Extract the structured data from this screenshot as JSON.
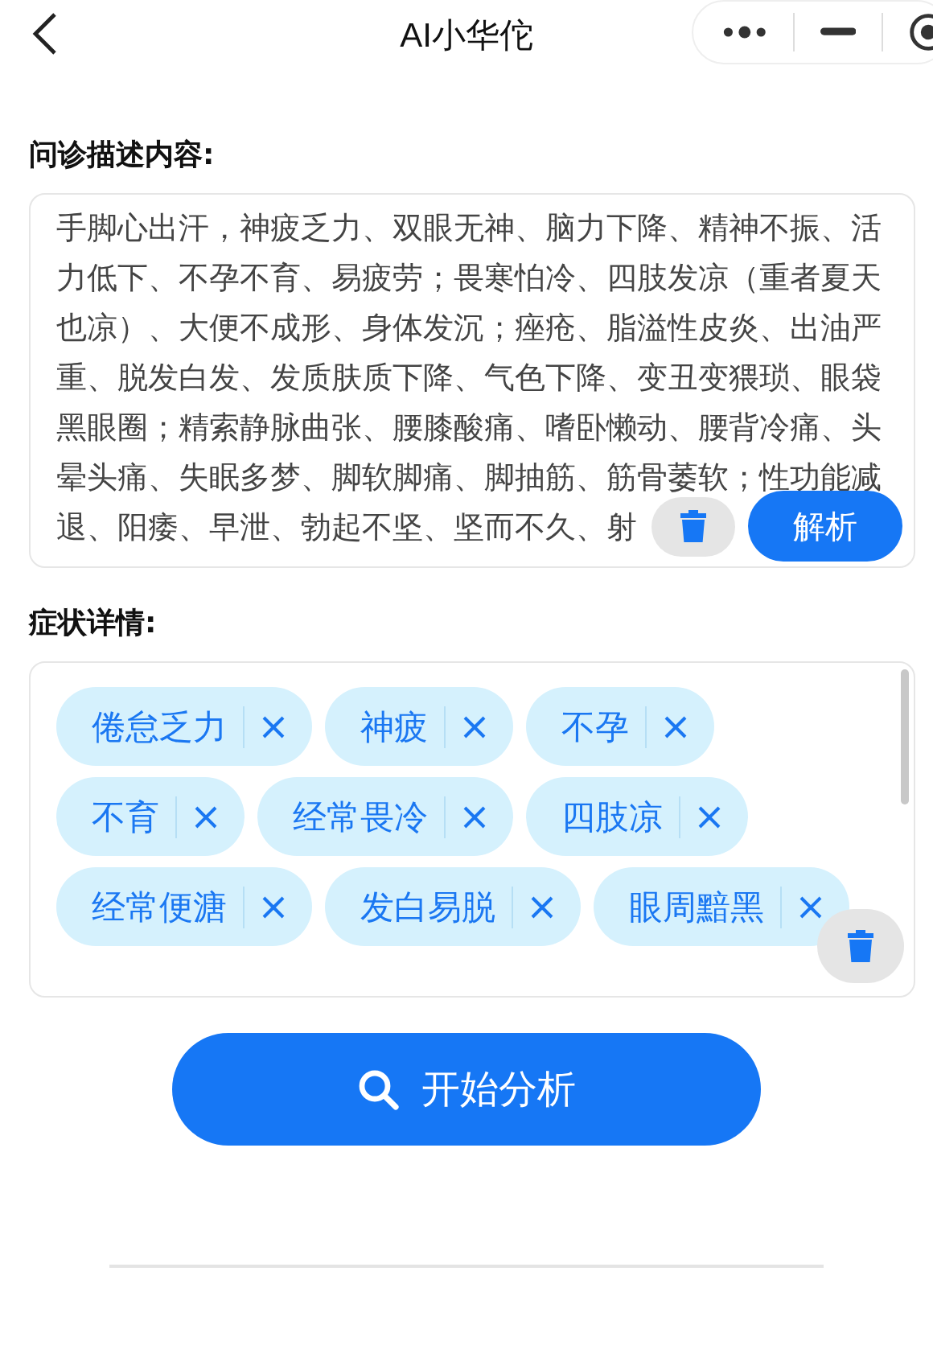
{
  "nav": {
    "title": "AI小华佗"
  },
  "description": {
    "label": "问诊描述内容:",
    "lines": [
      "手脚心出汗，神疲乏力、双眼无神、脑力下降、精神不振、活",
      "力低下、不孕不育、易疲劳；畏寒怕冷、四肢发凉（重者夏天",
      "也凉）、大便不成形、身体发沉；痤疮、脂溢性皮炎、出油严",
      "重、脱发白发、发质肤质下降、气色下降、变丑变猥琐、眼袋",
      "黑眼圈；精索静脉曲张、腰膝酸痛、嗜卧懒动、腰背冷痛、头",
      "晕头痛、失眠多梦、脚软脚痛、脚抽筋、筋骨萎软；性功能减",
      "退、阳痿、早泄、勃起不坚、坚而不久、射"
    ],
    "parse_button": "解析"
  },
  "symptoms": {
    "label": "症状详情:",
    "tags": [
      {
        "label": "倦怠乏力"
      },
      {
        "label": "神疲"
      },
      {
        "label": "不孕"
      },
      {
        "label": "不育"
      },
      {
        "label": "经常畏冷"
      },
      {
        "label": "四肢凉"
      },
      {
        "label": "经常便溏"
      },
      {
        "label": "发白易脱"
      },
      {
        "label": "眼周黯黑"
      }
    ]
  },
  "start_button": "开始分析"
}
